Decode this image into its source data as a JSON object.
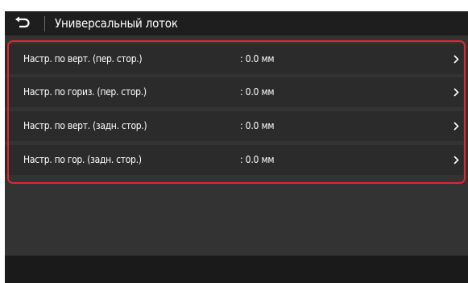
{
  "header": {
    "back_icon": "back-arrow-icon",
    "title": "Универсальный лоток"
  },
  "rows": [
    {
      "label": "Настр. по верт. (пер. стор.)",
      "value": ":  0.0 мм",
      "chevron_icon": "chevron-right-icon"
    },
    {
      "label": "Настр. по гориз. (пер. стор.)",
      "value": ":  0.0 мм",
      "chevron_icon": "chevron-right-icon"
    },
    {
      "label": "Настр. по верт. (задн. стор.)",
      "value": ":  0.0 мм",
      "chevron_icon": "chevron-right-icon"
    },
    {
      "label": "Настр. по гор. (задн. стор.)",
      "value": ":  0.0 мм",
      "chevron_icon": "chevron-right-icon"
    }
  ],
  "colors": {
    "highlight": "#e8242c",
    "background": "#333333",
    "header": "#1e1e1e",
    "row": "#2b2b2b"
  }
}
